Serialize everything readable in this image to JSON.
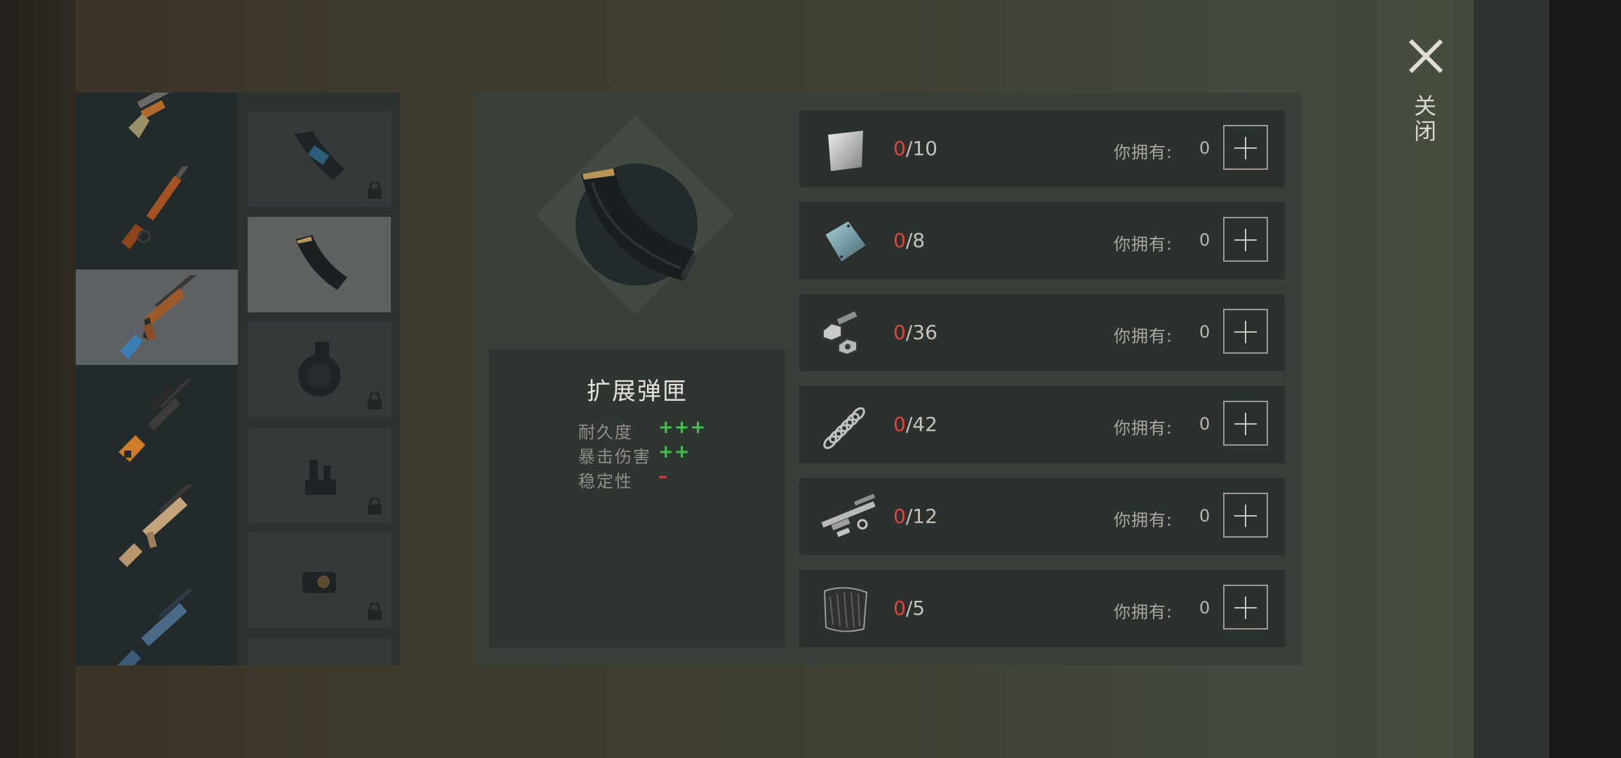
{
  "close": {
    "label": "关闭",
    "icon": "close-icon"
  },
  "weapons": [
    {
      "name": "shotgun-pump",
      "icon": "shotgun-icon",
      "selected": false
    },
    {
      "name": "lever-rifle",
      "icon": "lever-action-rifle-icon",
      "selected": false
    },
    {
      "name": "ak-rifle",
      "icon": "assault-rifle-icon",
      "selected": true
    },
    {
      "name": "sniper-rifle",
      "icon": "sniper-rifle-icon",
      "selected": false
    },
    {
      "name": "scar-rifle",
      "icon": "tan-rifle-icon",
      "selected": false
    },
    {
      "name": "m16-rifle",
      "icon": "m16-rifle-icon",
      "selected": false
    }
  ],
  "attachments": [
    {
      "icon": "taped-magazine-icon",
      "locked": true,
      "selected": false
    },
    {
      "icon": "extended-magazine-icon",
      "locked": false,
      "selected": true
    },
    {
      "icon": "drum-magazine-icon",
      "locked": true,
      "selected": false
    },
    {
      "icon": "iron-sight-icon",
      "locked": true,
      "selected": false
    },
    {
      "icon": "red-dot-sight-icon",
      "locked": true,
      "selected": false
    }
  ],
  "item": {
    "name": "扩展弹匣",
    "stats": [
      {
        "label": "耐久度",
        "value": "+++",
        "color": "#46c04d"
      },
      {
        "label": "暴击伤害",
        "value": "++",
        "color": "#46c04d"
      },
      {
        "label": "稳定性",
        "value": "–",
        "color": "#d63c34"
      }
    ]
  },
  "requirements": [
    {
      "icon": "metal-plate-icon",
      "have_now": "0",
      "need": "/10",
      "have_label": "你拥有:",
      "have_count": "0"
    },
    {
      "icon": "steel-plate-icon",
      "have_now": "0",
      "need": "/8",
      "have_label": "你拥有:",
      "have_count": "0"
    },
    {
      "icon": "nuts-bolts-icon",
      "have_now": "0",
      "need": "/36",
      "have_label": "你拥有:",
      "have_count": "0"
    },
    {
      "icon": "spring-icon",
      "have_now": "0",
      "need": "/42",
      "have_label": "你拥有:",
      "have_count": "0"
    },
    {
      "icon": "gun-parts-icon",
      "have_now": "0",
      "need": "/12",
      "have_label": "你拥有:",
      "have_count": "0"
    },
    {
      "icon": "rubber-sheet-icon",
      "have_now": "0",
      "need": "/5",
      "have_label": "你拥有:",
      "have_count": "0"
    }
  ]
}
